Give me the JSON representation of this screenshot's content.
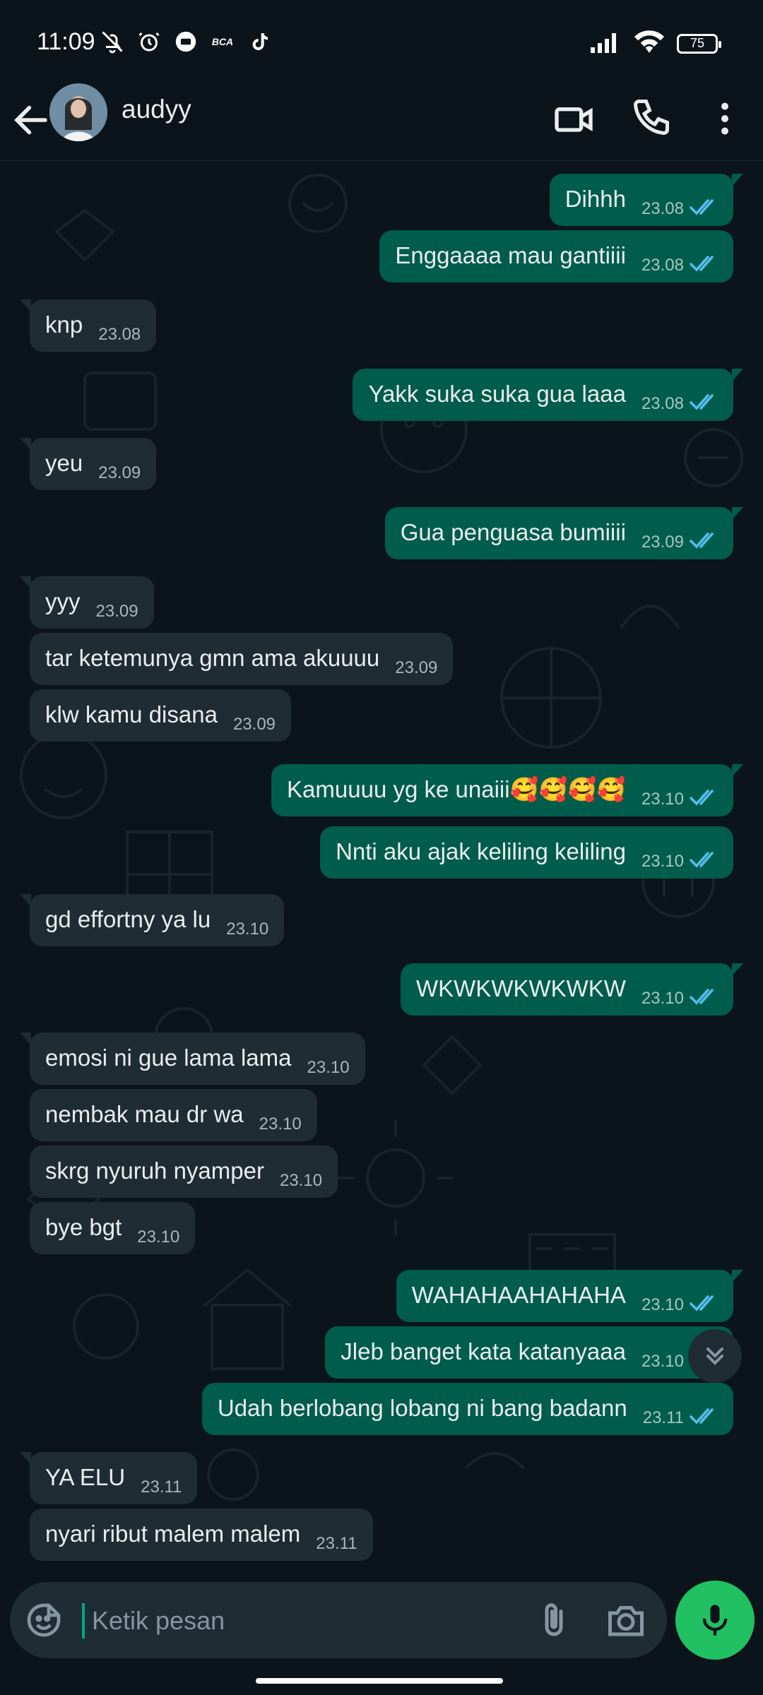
{
  "status_bar": {
    "time": "11:09",
    "battery": "75"
  },
  "header": {
    "contact_name": "audyy"
  },
  "messages": [
    {
      "dir": "out",
      "text": "Dihhh",
      "time": "23.08"
    },
    {
      "dir": "out",
      "text": "Enggaaaa mau gantiiii",
      "time": "23.08"
    },
    {
      "dir": "in",
      "text": "knp",
      "time": "23.08"
    },
    {
      "dir": "out",
      "text": "Yakk suka suka gua laaa",
      "time": "23.08"
    },
    {
      "dir": "in",
      "text": "yeu",
      "time": "23.09"
    },
    {
      "dir": "out",
      "text": "Gua penguasa bumiiii",
      "time": "23.09"
    },
    {
      "dir": "in",
      "text": "yyy",
      "time": "23.09"
    },
    {
      "dir": "in",
      "text": "tar ketemunya gmn ama akuuuu",
      "time": "23.09"
    },
    {
      "dir": "in",
      "text": "klw kamu disana",
      "time": "23.09"
    },
    {
      "dir": "out",
      "text": "Kamuuuu yg ke unaiii🥰🥰🥰🥰",
      "time": "23.10"
    },
    {
      "dir": "out",
      "text": "Nnti aku ajak keliling keliling",
      "time": "23.10"
    },
    {
      "dir": "in",
      "text": "gd effortny ya lu",
      "time": "23.10"
    },
    {
      "dir": "out",
      "text": "WKWKWKWKWKW",
      "time": "23.10"
    },
    {
      "dir": "in",
      "text": "emosi ni gue lama lama",
      "time": "23.10"
    },
    {
      "dir": "in",
      "text": "nembak mau dr wa",
      "time": "23.10"
    },
    {
      "dir": "in",
      "text": "skrg nyuruh nyamper",
      "time": "23.10"
    },
    {
      "dir": "in",
      "text": "bye bgt",
      "time": "23.10"
    },
    {
      "dir": "out",
      "text": "WAHAHAAHAHAHA",
      "time": "23.10"
    },
    {
      "dir": "out",
      "text": "Jleb banget kata katanyaaa",
      "time": "23.10"
    },
    {
      "dir": "out",
      "text": "Udah berlobang lobang ni bang badann",
      "time": "23.11"
    },
    {
      "dir": "in",
      "text": "YA ELU",
      "time": "23.11"
    },
    {
      "dir": "in",
      "text": "nyari ribut malem malem",
      "time": "23.11"
    }
  ],
  "input": {
    "placeholder": "Ketik pesan"
  },
  "icons": {
    "status": [
      "mute-icon",
      "alarm-icon",
      "app-icon",
      "bca-icon",
      "tiktok-icon",
      "signal-icon",
      "wifi-icon",
      "battery-icon"
    ],
    "header": [
      "back-arrow-icon",
      "video-call-icon",
      "phone-call-icon",
      "more-vert-icon"
    ],
    "input": [
      "emoji-icon",
      "attach-icon",
      "camera-icon",
      "mic-icon"
    ]
  },
  "colors": {
    "incoming": "#202c33",
    "outgoing": "#005c4b",
    "accent": "#21c063",
    "read_tick": "#53bdeb"
  }
}
